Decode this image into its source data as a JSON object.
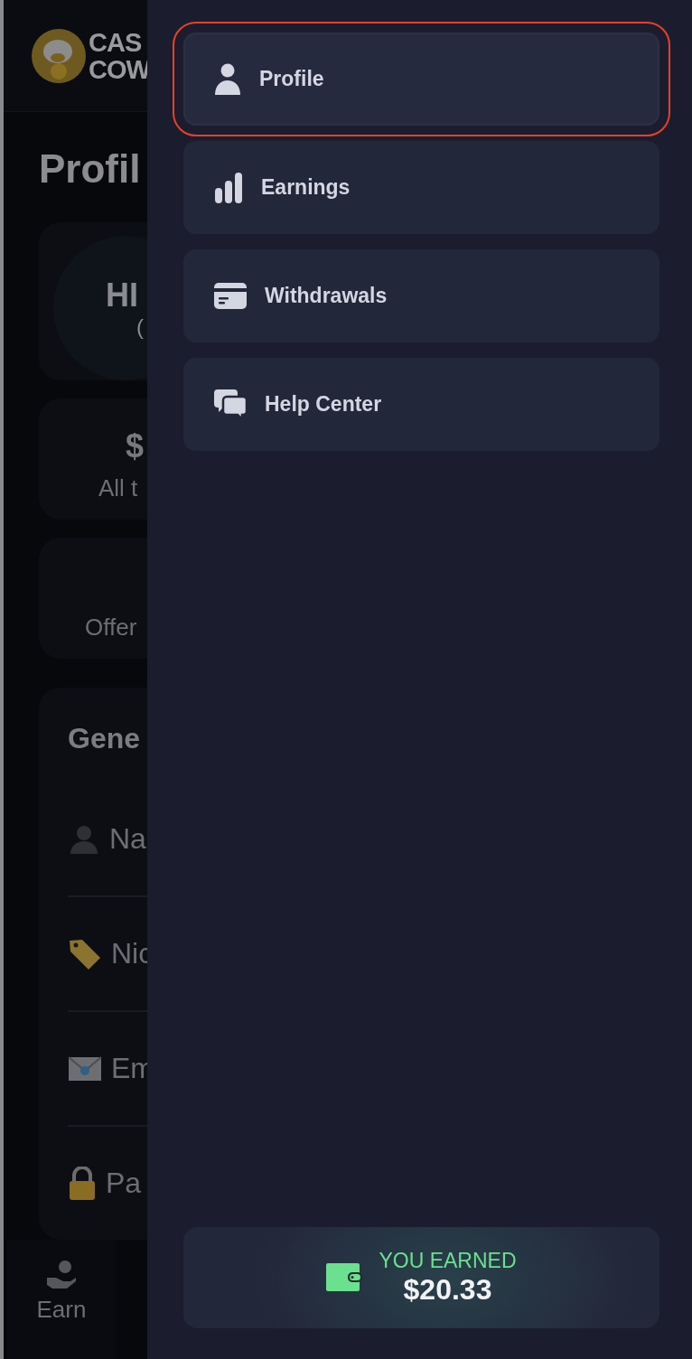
{
  "background_page": {
    "logo": {
      "line_1": "CAS",
      "line_2": "COW"
    },
    "title": "Profil",
    "profile_card": {
      "greeting": "HI",
      "subtext": "("
    },
    "stats_card": {
      "value": "$",
      "label": "All t"
    },
    "offers_card": {
      "label": "Offer"
    },
    "general_card": {
      "heading": "Gene",
      "rows": [
        {
          "kind": "person",
          "label": "Na"
        },
        {
          "kind": "tag",
          "label": "Nic"
        },
        {
          "kind": "mail",
          "label": "Em"
        },
        {
          "kind": "lock",
          "label": "Pa"
        }
      ]
    },
    "bottom_nav": {
      "label": "Earn"
    }
  },
  "drawer": {
    "items": [
      {
        "kind": "profile",
        "label": "Profile",
        "selected": true
      },
      {
        "kind": "earnings",
        "label": "Earnings",
        "selected": false
      },
      {
        "kind": "withdrawals",
        "label": "Withdrawals",
        "selected": false
      },
      {
        "kind": "help",
        "label": "Help Center",
        "selected": false
      }
    ],
    "earned": {
      "label": "YOU EARNED",
      "amount": "$20.33"
    }
  }
}
